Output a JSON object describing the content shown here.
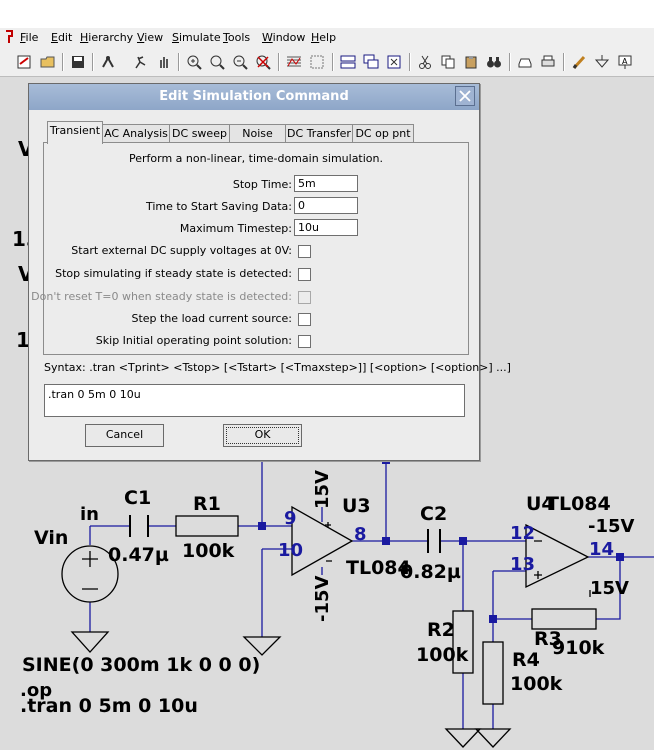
{
  "app": {
    "menu": [
      "File",
      "Edit",
      "Hierarchy",
      "View",
      "Simulate",
      "Tools",
      "Window",
      "Help"
    ],
    "menu_underline": [
      "F",
      "E",
      "H",
      "V",
      "S",
      "T",
      "W",
      "H"
    ],
    "toolbar_icons": [
      "new-schematic-icon",
      "open-icon",
      "save-icon",
      "control-panel-icon",
      "run-icon",
      "halt-icon",
      "zoom-in-icon",
      "pan-icon",
      "zoom-out-icon",
      "zoom-cancel-icon",
      "plot-icon",
      "autorange-icon",
      "tile-horizontal-icon",
      "cascade-icon",
      "close-all-icon",
      "cut-icon",
      "copy-icon",
      "paste-icon",
      "find-icon",
      "undo-icon",
      "print-icon",
      "wire-icon",
      "ground-icon",
      "label-icon"
    ]
  },
  "dialog": {
    "title": "Edit Simulation Command",
    "tabs": [
      "Transient",
      "AC Analysis",
      "DC sweep",
      "Noise",
      "DC Transfer",
      "DC op pnt"
    ],
    "active_tab": "Transient",
    "description": "Perform a non-linear, time-domain simulation.",
    "fields": [
      {
        "label": "Stop Time:",
        "value": "5m"
      },
      {
        "label": "Time to Start Saving Data:",
        "value": "0"
      },
      {
        "label": "Maximum Timestep:",
        "value": "10u"
      }
    ],
    "options": [
      {
        "label": "Start external DC supply voltages at 0V:",
        "checked": false,
        "disabled": false
      },
      {
        "label": "Stop simulating if steady state is detected:",
        "checked": false,
        "disabled": false
      },
      {
        "label": "Don't reset T=0 when steady state is detected:",
        "checked": false,
        "disabled": true
      },
      {
        "label": "Step the load current source:",
        "checked": false,
        "disabled": false
      },
      {
        "label": "Skip Initial operating point solution:",
        "checked": false,
        "disabled": false
      }
    ],
    "syntax": "Syntax:  .tran <Tprint> <Tstop> [<Tstart> [<Tmaxstep>]] [<option> [<option>] ...]",
    "command": ".tran 0 5m 0 10u",
    "cancel_label": "Cancel",
    "ok_label": "OK"
  },
  "schematic": {
    "left_partial": [
      "V",
      "15",
      "V",
      "1"
    ],
    "labels": {
      "in_net": "in",
      "vin": "Vin",
      "c1": "C1",
      "c1_val": "0.47µ",
      "r1": "R1",
      "r1_val": "100k",
      "u3": "U3",
      "u3_model": "TL084",
      "u3_pin9": "9",
      "u3_pin10": "10",
      "u3_pin8": "8",
      "u3_vpos": "15V",
      "u3_vneg": "-15V",
      "c2": "C2",
      "c2_val": "0.82µ",
      "u4": "U4",
      "u4_model": "TL084",
      "u4_vneg": "-15V",
      "u4_vpos": "15V",
      "u4_pin12": "12",
      "u4_pin13": "13",
      "u4_pin14": "14",
      "r2": "R2",
      "r2_val": "100k",
      "r3": "R3",
      "r3_val": "910k",
      "r4": "R4",
      "r4_val": "100k",
      "source_spec": "SINE(0 300m 1k 0 0 0)",
      "directive_op": ".op",
      "directive_tran": ".tran 0 5m 0 10u"
    },
    "colors": {
      "wire": "#1a1aa0",
      "component": "#000000",
      "junction": "#1a1aa0",
      "background": "#dcdcdc"
    }
  }
}
